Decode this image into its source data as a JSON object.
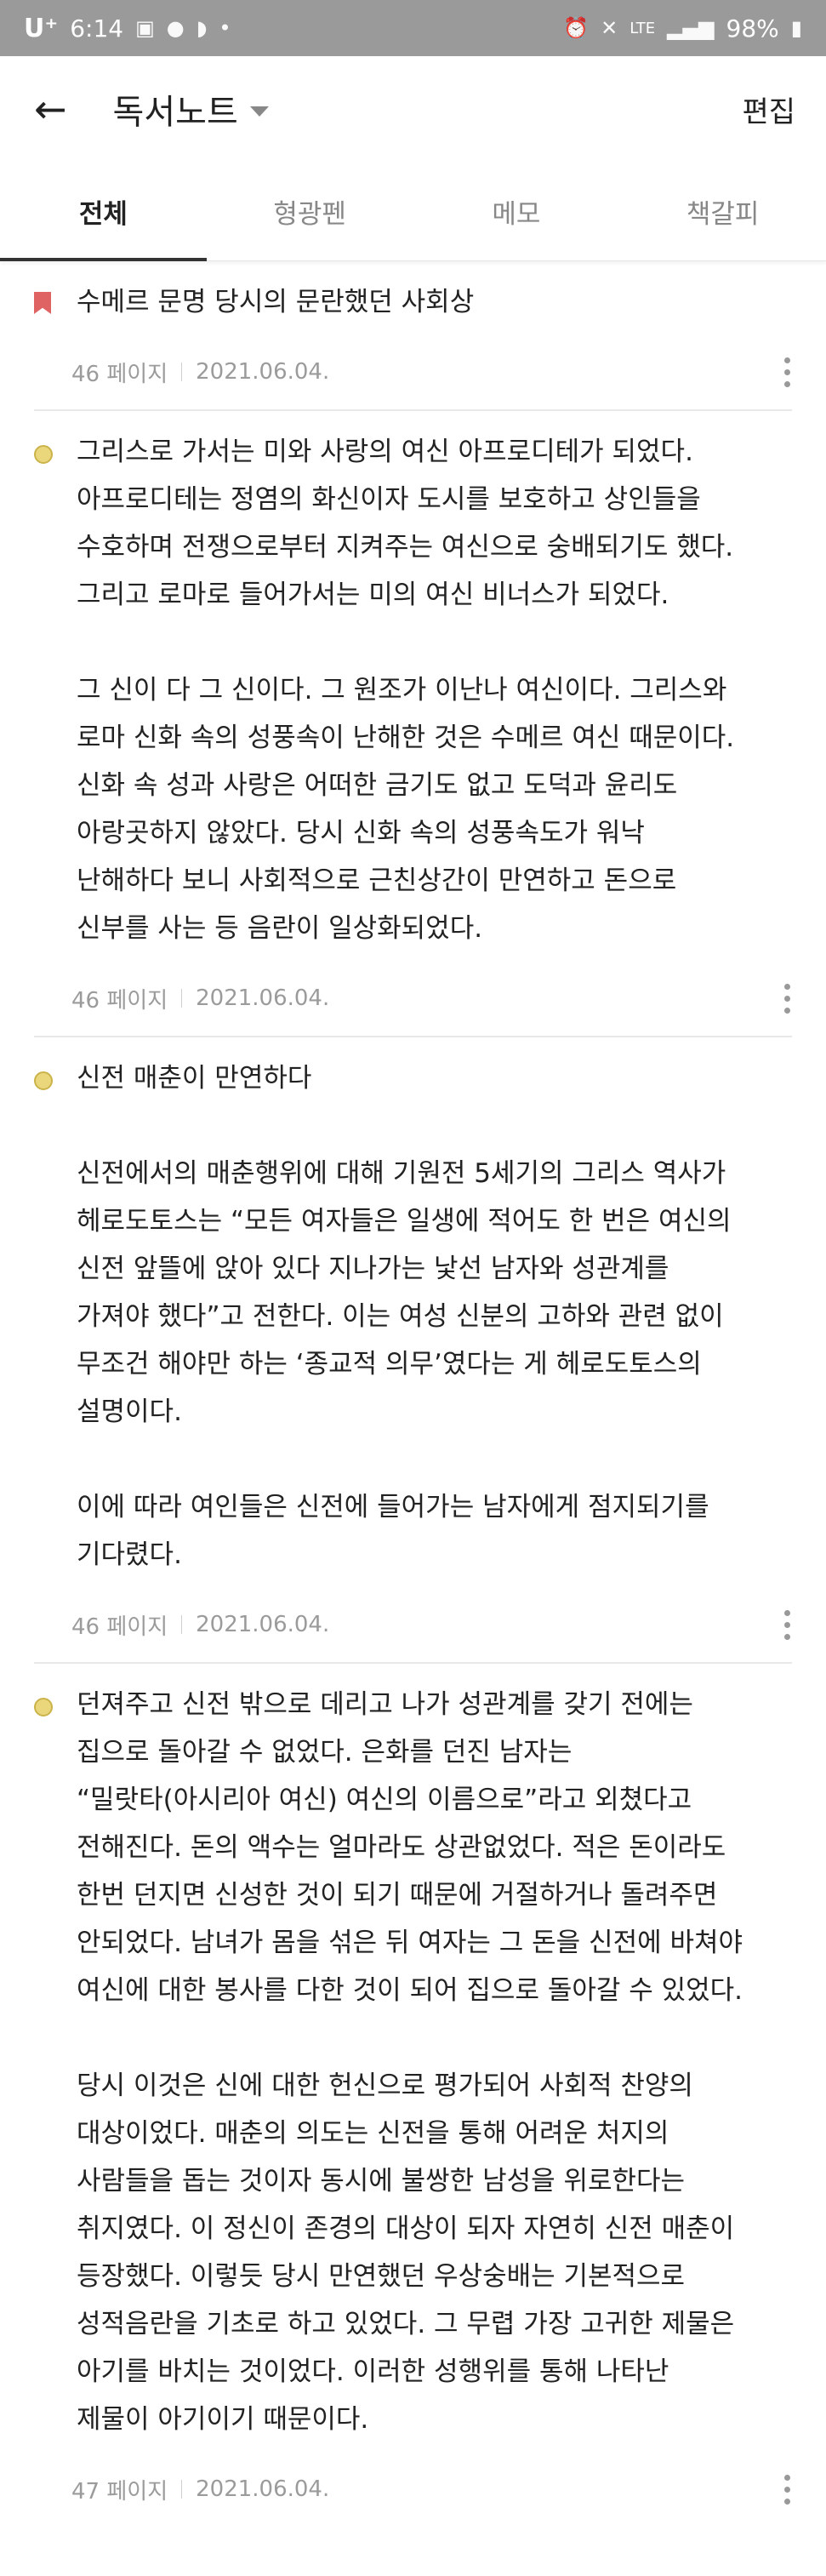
{
  "status_bar": {
    "carrier": "U⁺",
    "time": "6:14",
    "network": "LTE",
    "battery": "98%"
  },
  "app_bar": {
    "title": "독서노트",
    "edit_label": "편집"
  },
  "tabs": [
    {
      "label": "전체",
      "active": true
    },
    {
      "label": "형광펜",
      "active": false
    },
    {
      "label": "메모",
      "active": false
    },
    {
      "label": "책갈피",
      "active": false
    }
  ],
  "notes": [
    {
      "type": "bookmark",
      "text": "수메르 문명 당시의 문란했던 사회상",
      "page": "46 페이지",
      "date": "2021.06.04."
    },
    {
      "type": "highlight",
      "text": "그리스로 가서는 미와 사랑의 여신 아프로디테가 되었다.\n아프로디테는 정염의 화신이자 도시를 보호하고 상인들을\n수호하며 전쟁으로부터 지켜주는 여신으로 숭배되기도 했다.\n그리고 로마로 들어가서는 미의 여신 비너스가 되었다.\n\n  그 신이 다 그 신이다. 그 원조가 이난나 여신이다. 그리스와\n로마 신화 속의 성풍속이 난해한 것은 수메르 여신 때문이다.\n신화 속 성과 사랑은 어떠한 금기도 없고 도덕과 윤리도\n아랑곳하지 않았다. 당시 신화 속의 성풍속도가 워낙\n난해하다 보니 사회적으로 근친상간이 만연하고 돈으로\n신부를 사는 등 음란이 일상화되었다.",
      "page": "46 페이지",
      "date": "2021.06.04."
    },
    {
      "type": "highlight",
      "text": "신전 매춘이 만연하다\n\n  신전에서의 매춘행위에 대해 기원전 5세기의 그리스 역사가\n헤로도토스는 “모든 여자들은 일생에 적어도 한 번은 여신의\n신전 앞뜰에 앉아 있다 지나가는 낯선 남자와 성관계를\n가져야 했다”고 전한다. 이는 여성 신분의 고하와 관련 없이\n무조건 해야만 하는 ‘종교적 의무’였다는 게 헤로도토스의\n설명이다.\n\n  이에 따라 여인들은 신전에 들어가는 남자에게 점지되기를\n기다렸다.",
      "page": "46 페이지",
      "date": "2021.06.04."
    },
    {
      "type": "highlight",
      "text": "던져주고 신전 밖으로 데리고 나가 성관계를 갖기 전에는\n집으로 돌아갈 수 없었다. 은화를 던진 남자는\n“밀랏타(아시리아 여신) 여신의 이름으로”라고 외쳤다고\n전해진다. 돈의 액수는 얼마라도 상관없었다. 적은 돈이라도\n한번 던지면 신성한 것이 되기 때문에 거절하거나 돌려주면\n안되었다. 남녀가 몸을 섞은 뒤 여자는 그 돈을 신전에 바쳐야\n여신에 대한 봉사를 다한 것이 되어 집으로 돌아갈 수 있었다.\n\n  당시 이것은 신에 대한 헌신으로 평가되어 사회적 찬양의\n대상이었다. 매춘의 의도는 신전을 통해 어려운 처지의\n사람들을 돕는 것이자 동시에 불쌍한 남성을 위로한다는\n취지였다. 이 정신이 존경의 대상이 되자 자연히 신전 매춘이\n등장했다. 이렇듯 당시 만연했던 우상숭배는 기본적으로\n성적음란을 기초로 하고 있었다. 그 무렵 가장 고귀한 제물은\n아기를 바치는 것이었다. 이러한 성행위를 통해 나타난\n제물이 아기이기 때문이다.",
      "page": "47 페이지",
      "date": "2021.06.04."
    }
  ],
  "colors": {
    "bookmark": "#e06363",
    "highlight": "#ebd77b",
    "status_bar_bg": "#9a9a9a"
  },
  "icons": [
    "back-arrow-icon",
    "dropdown-caret-icon",
    "bookmark-icon",
    "highlight-dot-icon",
    "more-vertical-icon"
  ]
}
